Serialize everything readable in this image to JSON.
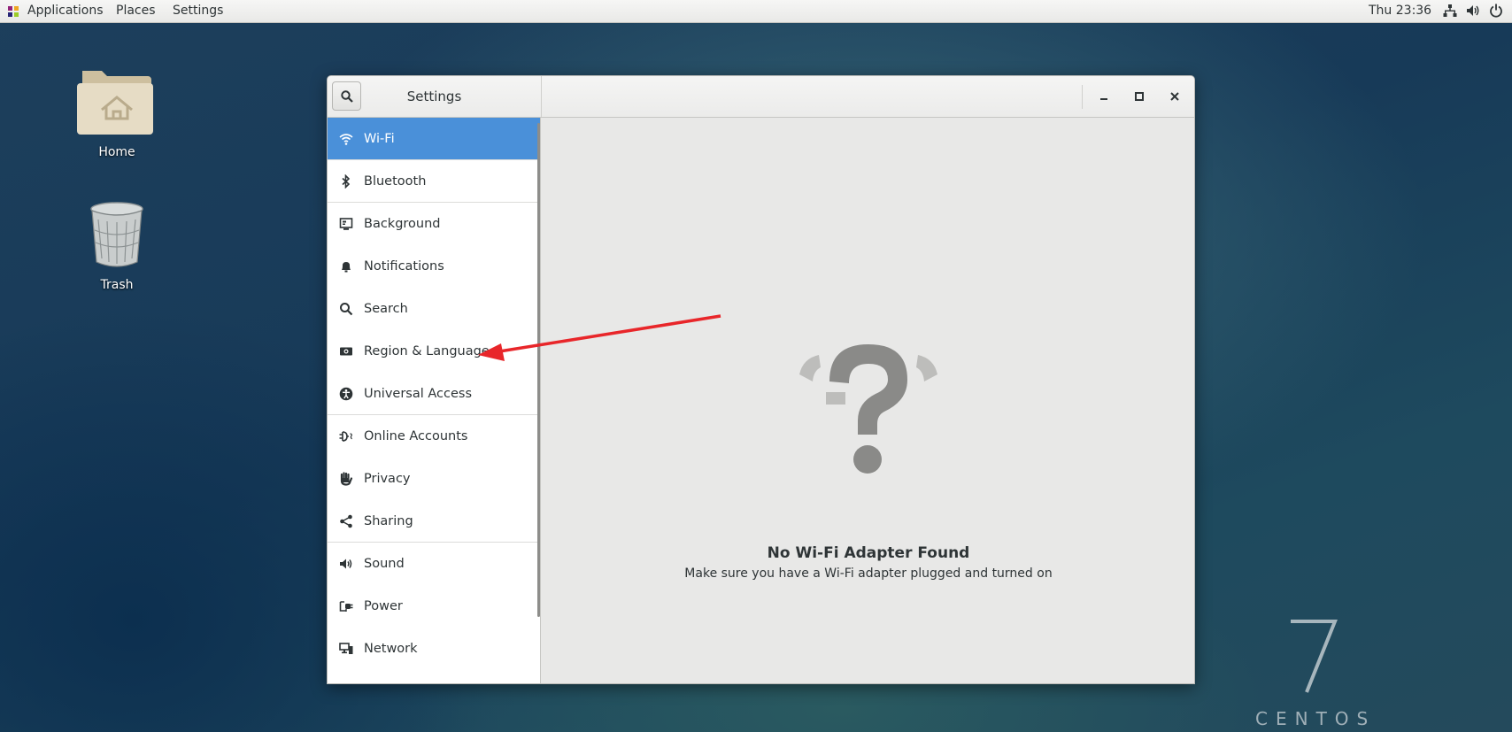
{
  "topbar": {
    "applications": "Applications",
    "places": "Places",
    "settings": "Settings",
    "clock": "Thu 23:36",
    "tray_icons": [
      "network-icon",
      "volume-icon",
      "power-icon"
    ]
  },
  "desktop": {
    "home_label": "Home",
    "trash_label": "Trash",
    "brand_text": "CENTOS",
    "brand_number": "7"
  },
  "window": {
    "title": "Settings",
    "controls": [
      "minimize-icon",
      "maximize-icon",
      "close-icon"
    ]
  },
  "sidebar": {
    "items": [
      {
        "label": "Wi-Fi",
        "icon": "wifi-icon",
        "active": true
      },
      {
        "label": "Bluetooth",
        "icon": "bluetooth-icon"
      },
      {
        "label": "Background",
        "icon": "background-icon"
      },
      {
        "label": "Notifications",
        "icon": "bell-icon"
      },
      {
        "label": "Search",
        "icon": "search-icon"
      },
      {
        "label": "Region & Language",
        "icon": "flag-icon"
      },
      {
        "label": "Universal Access",
        "icon": "accessibility-icon"
      },
      {
        "label": "Online Accounts",
        "icon": "online-accounts-icon"
      },
      {
        "label": "Privacy",
        "icon": "hand-icon"
      },
      {
        "label": "Sharing",
        "icon": "share-icon"
      },
      {
        "label": "Sound",
        "icon": "speaker-icon"
      },
      {
        "label": "Power",
        "icon": "power-plug-icon"
      },
      {
        "label": "Network",
        "icon": "network-icon"
      }
    ]
  },
  "content": {
    "heading": "No Wi-Fi Adapter Found",
    "subtext": "Make sure you have a Wi-Fi adapter plugged and turned on",
    "icon": "question-mark-icon"
  },
  "colors": {
    "accent": "#4a90d9",
    "annotation_arrow": "#e8262a"
  }
}
